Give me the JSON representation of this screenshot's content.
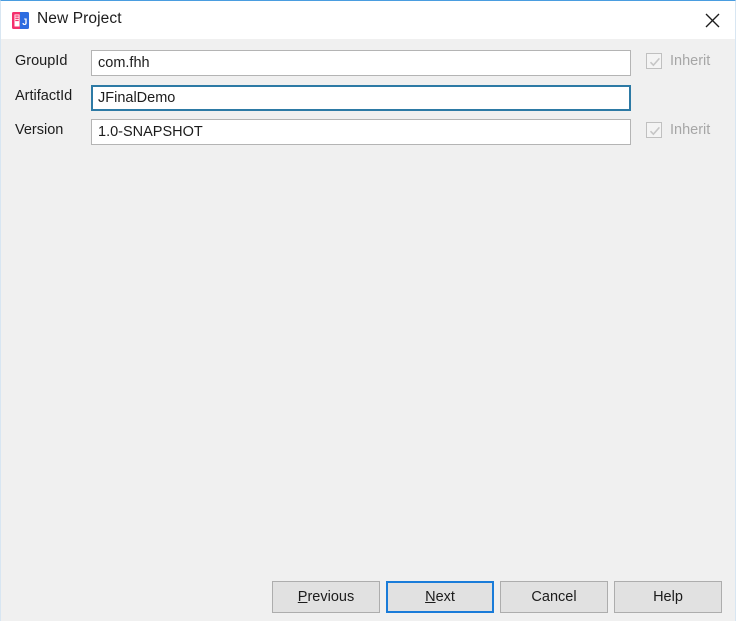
{
  "window": {
    "title": "New Project",
    "app_icon": "intellij-idea-icon",
    "close_icon": "close-icon",
    "accent_color": "#1a7cd9",
    "focus_border_color": "#2d7aa5",
    "background_color": "#f0f0f0",
    "titlebar_color": "#ffffff"
  },
  "form": {
    "fields": [
      {
        "label": "GroupId",
        "value": "com.fhh",
        "placeholder": "",
        "focused": false,
        "inherit": {
          "label": "Inherit",
          "checked": true,
          "enabled": false,
          "visible": true
        }
      },
      {
        "label": "ArtifactId",
        "value": "JFinalDemo",
        "placeholder": "",
        "focused": true,
        "inherit": {
          "label": "",
          "checked": false,
          "enabled": false,
          "visible": false
        }
      },
      {
        "label": "Version",
        "value": "1.0-SNAPSHOT",
        "placeholder": "",
        "focused": false,
        "inherit": {
          "label": "Inherit",
          "checked": true,
          "enabled": false,
          "visible": true
        }
      }
    ]
  },
  "buttons": [
    {
      "label": "Previous",
      "mnemonic": "P",
      "default": false
    },
    {
      "label": "Next",
      "mnemonic": "N",
      "default": true
    },
    {
      "label": "Cancel",
      "mnemonic": "",
      "default": false
    },
    {
      "label": "Help",
      "mnemonic": "",
      "default": false
    }
  ]
}
